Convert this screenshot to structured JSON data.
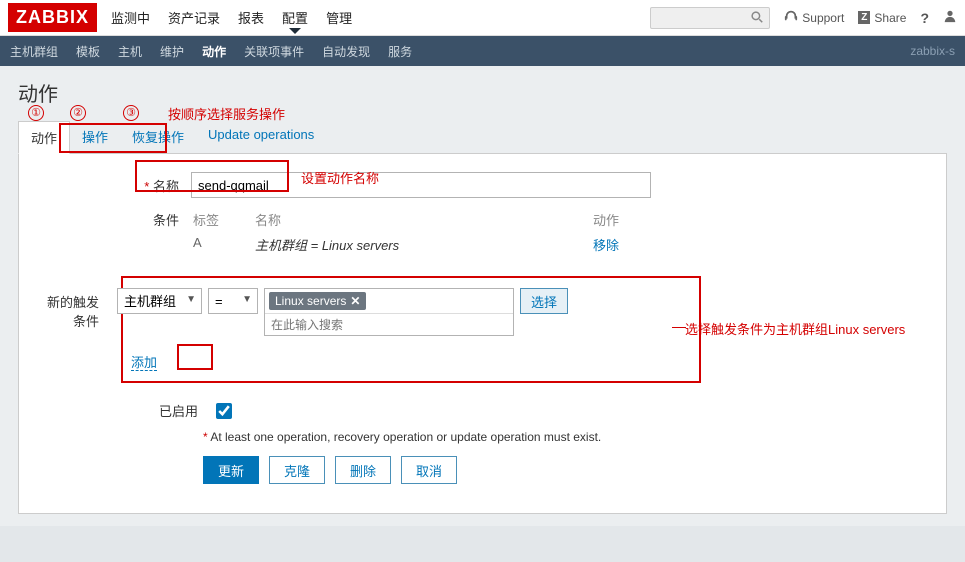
{
  "header": {
    "logo": "ZABBIX",
    "nav": {
      "monitor": "监测中",
      "inventory": "资产记录",
      "reports": "报表",
      "config": "配置",
      "admin": "管理"
    },
    "support": "Support",
    "share": "Share"
  },
  "subnav": {
    "hostgroups": "主机群组",
    "templates": "模板",
    "hosts": "主机",
    "maint": "维护",
    "actions": "动作",
    "eventcorr": "关联项事件",
    "discovery": "自动发现",
    "services": "服务",
    "hostname": "zabbix-s"
  },
  "page_title": "动作",
  "tabs": {
    "action": "动作",
    "ops": "操作",
    "recovery": "恢复操作",
    "update": "Update operations"
  },
  "annots": {
    "order": "按顺序选择服务操作",
    "name": "设置动作名称",
    "trigger": "选择触发条件为主机群组Linux servers",
    "c1": "①",
    "c2": "②",
    "c3": "③"
  },
  "form": {
    "name_label": "名称",
    "name_value": "send-qqmail",
    "cond_label": "条件",
    "cond": {
      "th_tag": "标签",
      "th_name": "名称",
      "th_act": "动作",
      "tag": "A",
      "name": "主机群组 = Linux servers",
      "remove": "移除"
    },
    "newcond_label": "新的触发条件",
    "sel_type": "主机群组",
    "sel_op": "=",
    "chip": "Linux servers",
    "search_ph": "在此输入搜索",
    "select_btn": "选择",
    "add": "添加",
    "enabled_label": "已启用",
    "warn": "At least one operation, recovery operation or update operation must exist.",
    "btn_update": "更新",
    "btn_clone": "克隆",
    "btn_delete": "删除",
    "btn_cancel": "取消"
  }
}
